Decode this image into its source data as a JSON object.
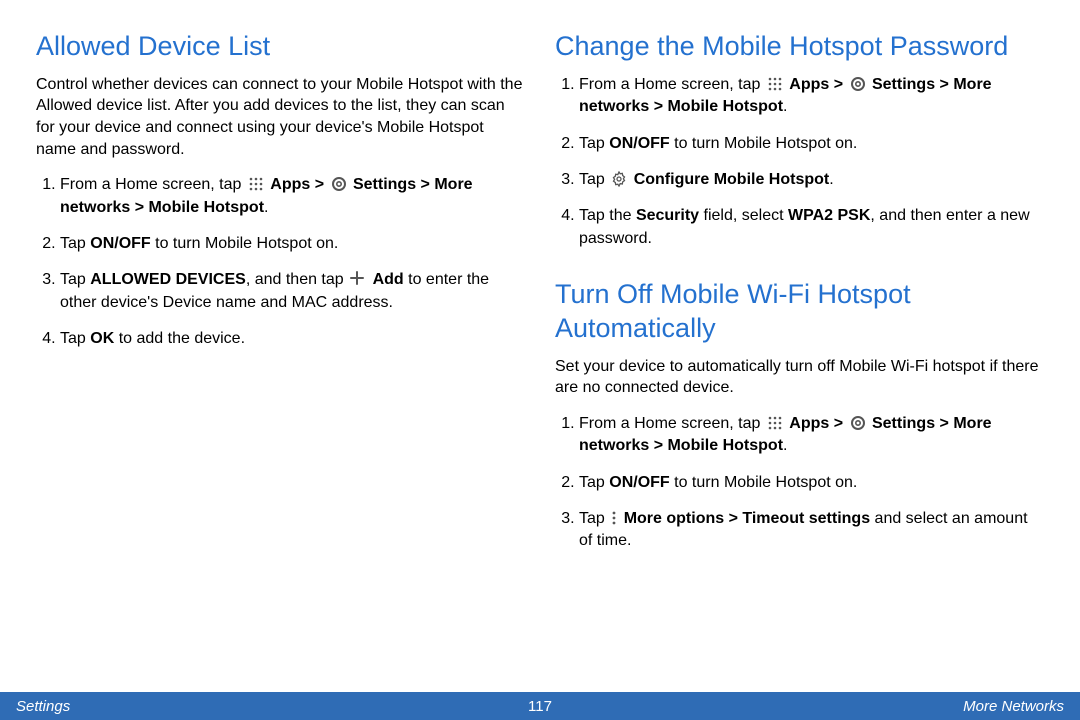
{
  "left": {
    "section1": {
      "title": "Allowed Device List",
      "intro": "Control whether devices can connect to your Mobile Hotspot with the Allowed device list. After you add devices to the list, they can scan for your device and connect using your device's Mobile Hotspot name and password.",
      "step1_a": "From a Home screen, tap ",
      "step1_apps": "Apps > ",
      "step1_settings": "Settings > More networks > Mobile Hotspot",
      "step1_end": ".",
      "step2_a": "Tap ",
      "step2_b": "ON/OFF",
      "step2_c": " to turn Mobile Hotspot on.",
      "step3_a": "Tap ",
      "step3_b": "ALLOWED DEVICES",
      "step3_c": ", and then tap ",
      "step3_add": "Add",
      "step3_d": " to enter the other device's Device name and MAC address.",
      "step4_a": "Tap ",
      "step4_b": "OK",
      "step4_c": " to add the device."
    }
  },
  "right": {
    "section1": {
      "title": "Change the Mobile Hotspot Password",
      "step1_a": "From a Home screen, tap ",
      "step1_apps": "Apps > ",
      "step1_settings": "Settings > More networks > Mobile Hotspot",
      "step1_end": ".",
      "step2_a": "Tap ",
      "step2_b": "ON/OFF",
      "step2_c": " to turn Mobile Hotspot on.",
      "step3_a": "Tap ",
      "step3_b": "Configure Mobile Hotspot",
      "step3_c": ".",
      "step4_a": "Tap the ",
      "step4_b": "Security",
      "step4_c": " field, select ",
      "step4_d": "WPA2 PSK",
      "step4_e": ", and then enter a new password."
    },
    "section2": {
      "title": "Turn Off Mobile Wi-Fi Hotspot Automatically",
      "intro": "Set your device to automatically turn off Mobile Wi-Fi hotspot if there are no connected device.",
      "step1_a": "From a Home screen, tap ",
      "step1_apps": "Apps > ",
      "step1_settings": "Settings > More networks > Mobile Hotspot",
      "step1_end": ".",
      "step2_a": "Tap ",
      "step2_b": "ON/OFF",
      "step2_c": " to turn Mobile Hotspot on.",
      "step3_a": "Tap ",
      "step3_b": "More options > Timeout settings",
      "step3_c": " and select an amount of time."
    }
  },
  "footer": {
    "left": "Settings",
    "center": "117",
    "right": "More Networks"
  }
}
